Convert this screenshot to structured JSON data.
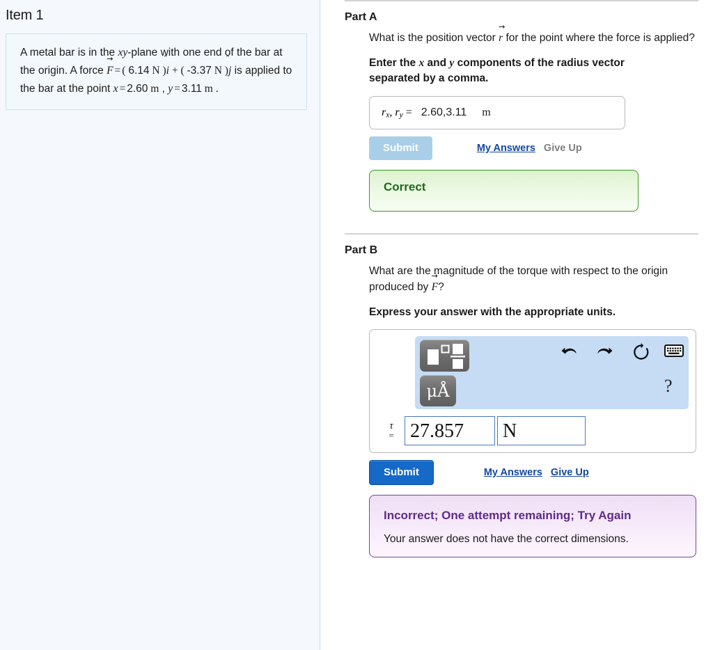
{
  "left": {
    "item_title": "Item 1",
    "problem": {
      "line_a": "A metal bar is in the ",
      "xy": "xy",
      "line_b": "-plane with one end of the bar at the origin. A force ",
      "force_symbol": "F",
      "force_x_value": "6.14",
      "force_x_unit": "N",
      "i_hat": "i",
      "force_y_value": "-3.37",
      "force_y_unit": "N",
      "j_hat": "j",
      "line_c": " is applied to the bar at the point ",
      "x_symbol": "x",
      "x_value": "2.60",
      "x_unit": "m",
      "y_symbol": "y",
      "y_value": "3.11",
      "y_unit": "m"
    }
  },
  "partA": {
    "heading": "Part A",
    "question": "What is the position vector ",
    "question_vector": "r",
    "question_tail": " for the point where the force is applied?",
    "instruction_1": "Enter the ",
    "instruction_x": "x",
    "instruction_2": " and ",
    "instruction_y": "y",
    "instruction_3": " components of the radius vector separated by a comma.",
    "field": {
      "label_r": "r",
      "label_sub_x": "x",
      "label_comma": ", ",
      "label_sub_y": "y",
      "label_eq": "=",
      "value": "2.60,3.11",
      "units": "m"
    },
    "submit_label": "Submit",
    "my_answers_label": "My Answers",
    "give_up_label": "Give Up",
    "feedback": {
      "title": "Correct",
      "state": "correct"
    }
  },
  "partB": {
    "heading": "Part B",
    "question": "What are the magnitude of the torque with respect to the origin produced by ",
    "question_vector": "F",
    "question_tail": "?",
    "instruction": "Express your answer with the appropriate units.",
    "toolbar": {
      "template_fraction_name": "math-template",
      "template_units_glyph": "μÅ",
      "undo_name": "undo",
      "redo_name": "redo",
      "reset_name": "reset",
      "keyboard_name": "keyboard",
      "help_glyph": "?"
    },
    "field": {
      "label_tau": "τ",
      "label_eq": "=",
      "value": "27.857",
      "units": "N"
    },
    "submit_label": "Submit",
    "my_answers_label": "My Answers",
    "give_up_label": "Give Up",
    "feedback": {
      "title": "Incorrect; One attempt remaining; Try Again",
      "body": "Your answer does not have the correct dimensions.",
      "state": "incorrect"
    }
  },
  "colors": {
    "panel_bg": "#f5f9fd",
    "submit_active": "#1569c7",
    "submit_disabled": "#a9cfe8",
    "link_blue": "#15489f",
    "correct_border": "#3a9a23",
    "correct_text": "#1b6b1b",
    "incorrect_border": "#7e3f9d",
    "incorrect_text": "#5e2a87",
    "toolbar_bg": "#c6dcf4",
    "input_border": "#4679c4"
  }
}
